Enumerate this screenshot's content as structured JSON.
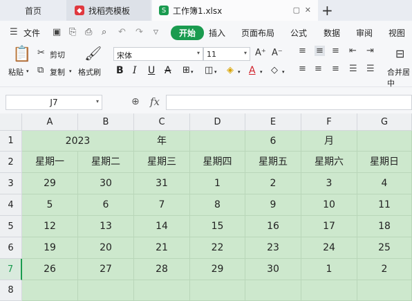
{
  "tabs": {
    "home": "首页",
    "template": "找稻壳模板",
    "document": "工作簿1.xlsx"
  },
  "menu": {
    "file": "文件",
    "items": [
      "开始",
      "插入",
      "页面布局",
      "公式",
      "数据",
      "审阅",
      "视图"
    ]
  },
  "ribbon": {
    "paste": "粘贴",
    "cut": "剪切",
    "copy": "复制",
    "format_painter": "格式刷",
    "font_name": "宋体",
    "font_size": "11",
    "merge": "合并居中"
  },
  "formula_bar": {
    "name_box": "J7",
    "fx": "fx",
    "value": ""
  },
  "sheet": {
    "columns": [
      "A",
      "B",
      "C",
      "D",
      "E",
      "F",
      "G"
    ],
    "rows": [
      "1",
      "2",
      "3",
      "4",
      "5",
      "6",
      "7",
      "8"
    ],
    "active_row": "7",
    "row1": {
      "year": "2023",
      "nian": "年",
      "month": "6",
      "yue": "月"
    },
    "weekdays": [
      "星期一",
      "星期二",
      "星期三",
      "星期四",
      "星期五",
      "星期六",
      "星期日"
    ],
    "weeks": [
      [
        "29",
        "30",
        "31",
        "1",
        "2",
        "3",
        "4"
      ],
      [
        "5",
        "6",
        "7",
        "8",
        "9",
        "10",
        "11"
      ],
      [
        "12",
        "13",
        "14",
        "15",
        "16",
        "17",
        "18"
      ],
      [
        "19",
        "20",
        "21",
        "22",
        "23",
        "24",
        "25"
      ],
      [
        "26",
        "27",
        "28",
        "29",
        "30",
        "1",
        "2"
      ]
    ]
  },
  "colors": {
    "accent": "#1a9b4f",
    "cell_fill": "#cde8cd"
  }
}
